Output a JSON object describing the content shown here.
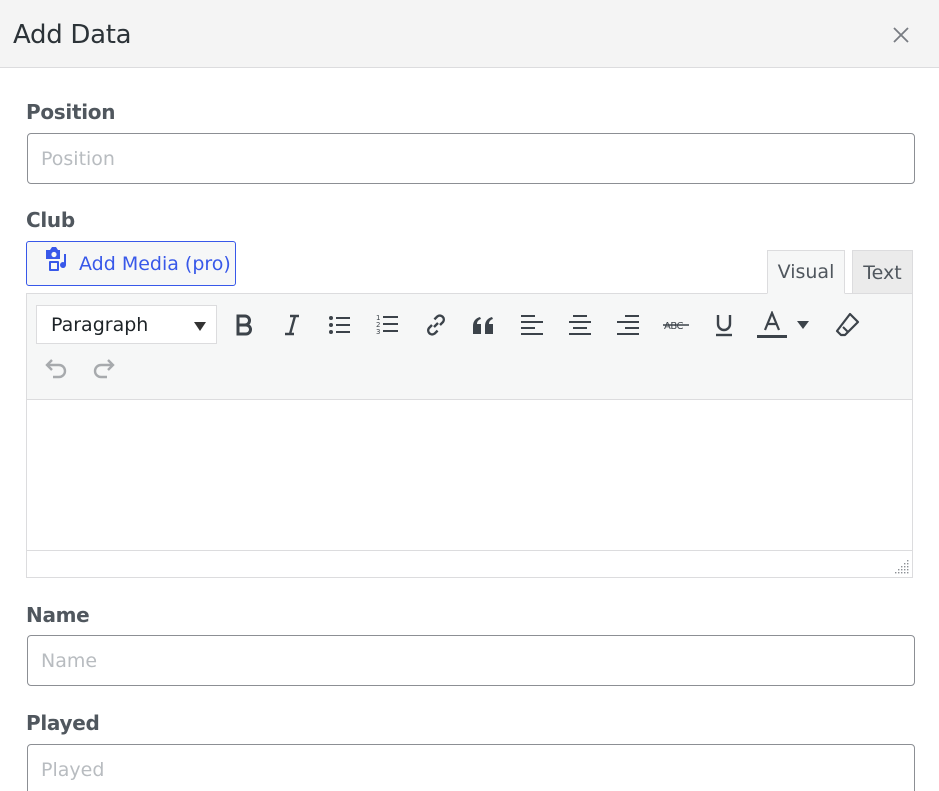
{
  "modal": {
    "title": "Add Data",
    "close_icon": "close-icon"
  },
  "fields": {
    "position": {
      "label": "Position",
      "placeholder": "Position",
      "value": ""
    },
    "club": {
      "label": "Club"
    },
    "name": {
      "label": "Name",
      "placeholder": "Name",
      "value": ""
    },
    "played": {
      "label": "Played",
      "placeholder": "Played",
      "value": ""
    }
  },
  "editor": {
    "add_media_label": "Add Media (pro)",
    "add_media_icon": "media-icon",
    "tabs": [
      {
        "label": "Visual",
        "active": true
      },
      {
        "label": "Text",
        "active": false
      }
    ],
    "format_select": "Paragraph",
    "toolbar_icons": [
      "bold-icon",
      "italic-icon",
      "bullet-list-icon",
      "numbered-list-icon",
      "link-icon",
      "blockquote-icon",
      "align-left-icon",
      "align-center-icon",
      "align-right-icon",
      "strikethrough-icon",
      "underline-icon",
      "text-color-icon",
      "clear-formatting-icon",
      "undo-icon",
      "redo-icon"
    ],
    "content": ""
  },
  "colors": {
    "accent": "#3858e9",
    "header_bg": "#f4f4f4",
    "toolbar_bg": "#f6f7f7",
    "border": "#8c8f94"
  }
}
